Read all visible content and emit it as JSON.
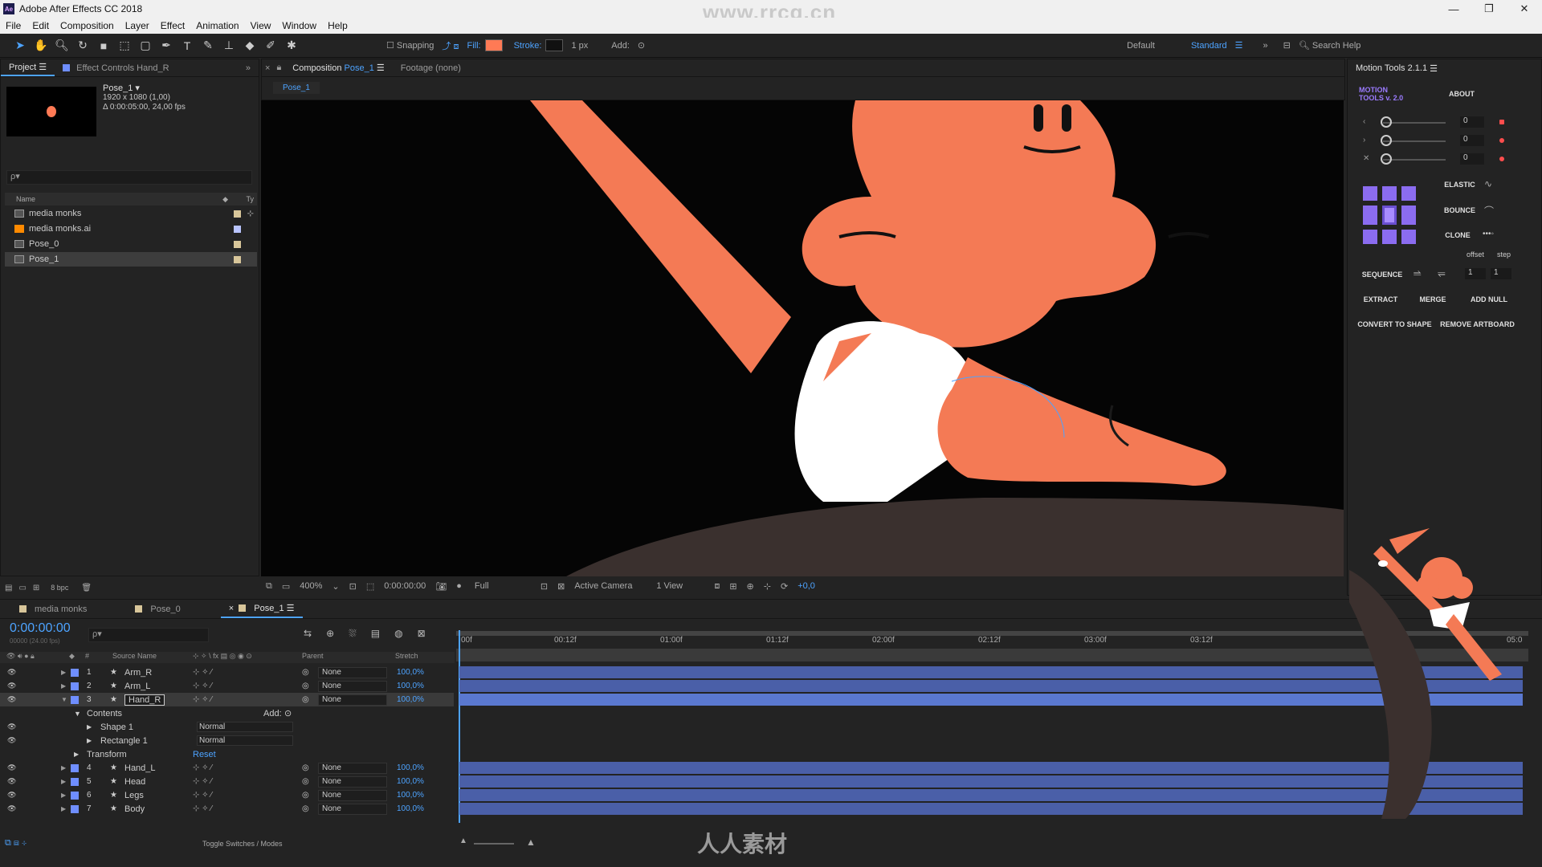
{
  "window": {
    "title": "Adobe After Effects CC 2018",
    "watermark": "www.rrcg.cn",
    "min": "—",
    "max": "❐",
    "close": "✕"
  },
  "menu": [
    "File",
    "Edit",
    "Composition",
    "Layer",
    "Effect",
    "Animation",
    "View",
    "Window",
    "Help"
  ],
  "toolbar": {
    "snapping": "Snapping",
    "fill": "Fill:",
    "stroke": "Stroke:",
    "stroke_width": "1 px",
    "add": "Add:",
    "workspace_default": "Default",
    "workspace_standard": "Standard",
    "search_help": "Search Help",
    "fill_color": "#ff7a55",
    "stroke_color": "#111111"
  },
  "project": {
    "tab_project": "Project",
    "tab_effect": "Effect Controls Hand_R",
    "comp_name": "Pose_1 ▾",
    "comp_dims": "1920 x 1080 (1,00)",
    "comp_duration": "Δ 0:00:05:00, 24,00 fps",
    "search_placeholder": "ρ▾",
    "col_name": "Name",
    "col_type": "Ty",
    "items": [
      {
        "name": "media monks"
      },
      {
        "name": "media monks.ai"
      },
      {
        "name": "Pose_0"
      },
      {
        "name": "Pose_1"
      }
    ],
    "bpc": "8 bpc"
  },
  "composition": {
    "tab_label": "Composition",
    "tab_comp": "Pose_1",
    "footage": "Footage (none)",
    "subtab": "Pose_1",
    "zoom": "400%",
    "time": "0:00:00:00",
    "resolution": "Full",
    "camera": "Active Camera",
    "views": "1 View",
    "exposure": "+0,0"
  },
  "motion_tools": {
    "title": "Motion Tools 2.1.1",
    "logo_line1": "MOTION",
    "logo_line2": "TOOLS v. 2.0",
    "about": "ABOUT",
    "slider_values": [
      "0",
      "0",
      "0"
    ],
    "elastic": "ELASTIC",
    "bounce": "BOUNCE",
    "clone": "CLONE",
    "offset": "offset",
    "step": "step",
    "sequence": "SEQUENCE",
    "seq_values": [
      "1",
      "1"
    ],
    "extract": "EXTRACT",
    "merge": "MERGE",
    "add_null": "ADD NULL",
    "convert": "CONVERT TO SHAPE",
    "remove_artboard": "REMOVE ARTBOARD"
  },
  "timeline": {
    "tabs": [
      "media monks",
      "Pose_0",
      "Pose_1"
    ],
    "timecode": "0:00:00:00",
    "frames": "00000 (24.00 fps)",
    "col_source": "Source Name",
    "col_parent": "Parent",
    "col_stretch": "Stretch",
    "ruler": [
      "00f",
      "00:12f",
      "01:00f",
      "01:12f",
      "02:00f",
      "02:12f",
      "03:00f",
      "03:12f",
      "05:0"
    ],
    "layers": [
      {
        "num": "1",
        "name": "Arm_R",
        "parent": "None",
        "stretch": "100,0%"
      },
      {
        "num": "2",
        "name": "Arm_L",
        "parent": "None",
        "stretch": "100,0%"
      },
      {
        "num": "3",
        "name": "Hand_R",
        "parent": "None",
        "stretch": "100,0%"
      }
    ],
    "contents_label": "Contents",
    "add_label": "Add:",
    "shape1": "Shape 1",
    "rect1": "Rectangle 1",
    "mode_normal": "Normal",
    "transform": "Transform",
    "reset": "Reset",
    "layers2": [
      {
        "num": "4",
        "name": "Hand_L",
        "parent": "None",
        "stretch": "100,0%"
      },
      {
        "num": "5",
        "name": "Head",
        "parent": "None",
        "stretch": "100,0%"
      },
      {
        "num": "6",
        "name": "Legs",
        "parent": "None",
        "stretch": "100,0%"
      },
      {
        "num": "7",
        "name": "Body",
        "parent": "None",
        "stretch": "100,0%"
      }
    ],
    "toggle": "Toggle Switches / Modes"
  },
  "footer_watermark": "人人素材"
}
